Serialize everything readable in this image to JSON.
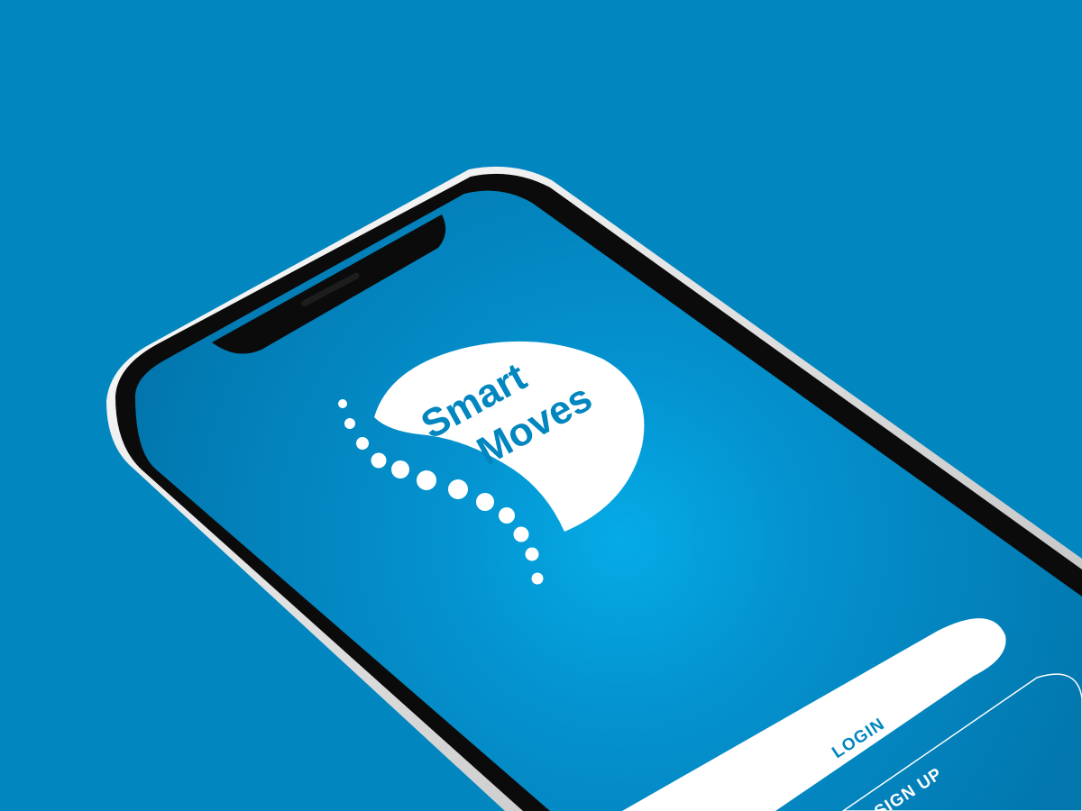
{
  "app": {
    "name_line1": "Smart",
    "name_line2": "Moves"
  },
  "actions": {
    "login_label": "LOGIN",
    "signup_label": "SIGN UP"
  },
  "colors": {
    "background": "#0286bf",
    "screen_center": "#05a9e3",
    "screen_edge": "#0278b0",
    "logo_fill": "#ffffff",
    "brand_text": "#0286bf",
    "device_frame": "#0a0a0a",
    "device_bezel": "#e9e9e9"
  },
  "icons": {
    "logo": "smart-moves-logo",
    "spine_dots": "spine-dots-icon"
  }
}
